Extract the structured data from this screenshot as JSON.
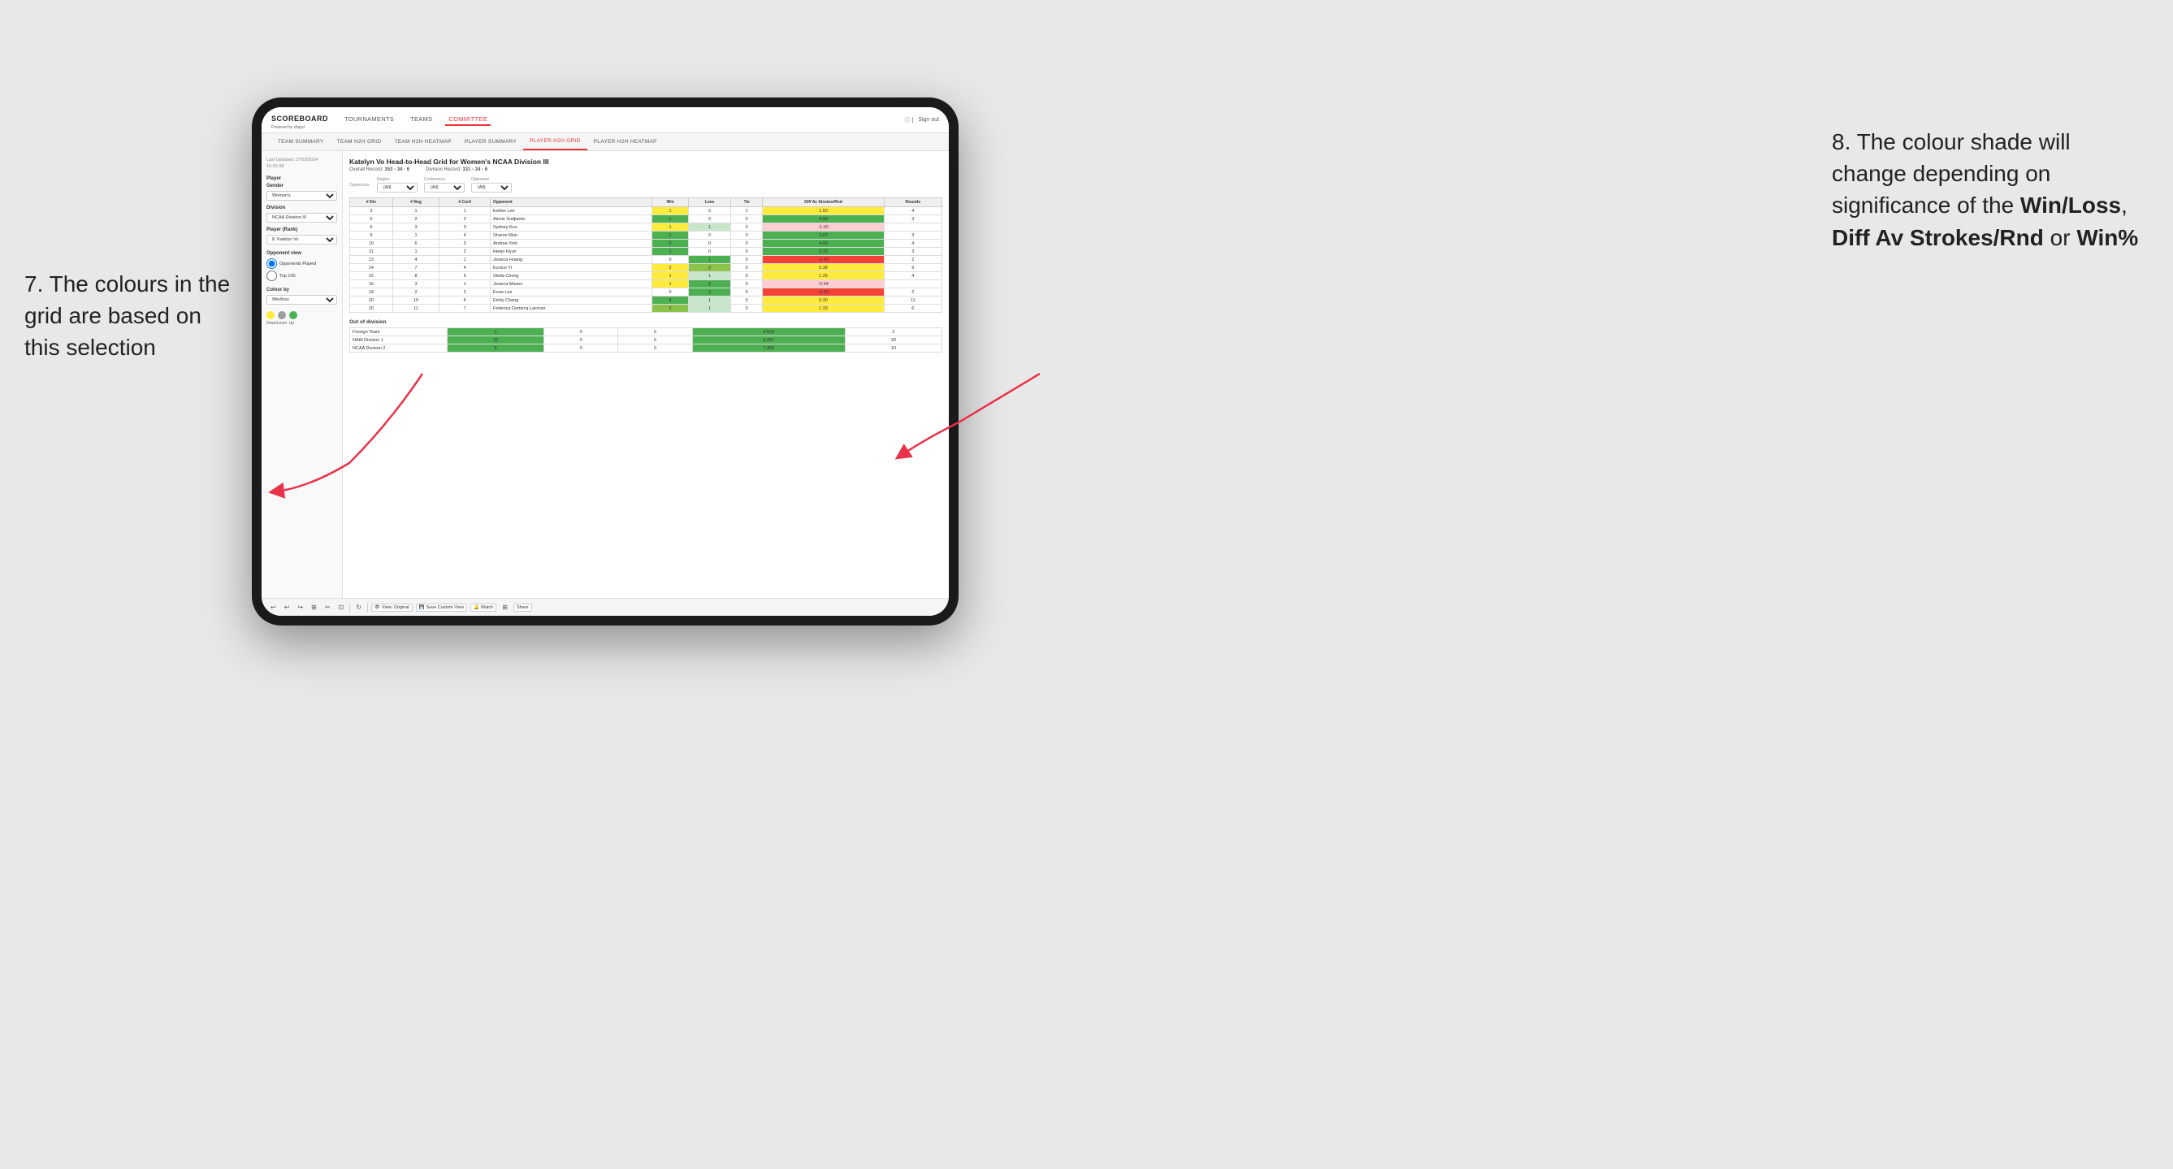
{
  "annotations": {
    "left": {
      "text": "7. The colours in the grid are based on this selection"
    },
    "right": {
      "intro": "8. The colour shade will change depending on significance of the ",
      "bold1": "Win/Loss",
      "sep1": ", ",
      "bold2": "Diff Av Strokes/Rnd",
      "sep2": " or ",
      "bold3": "Win%"
    }
  },
  "app": {
    "logo": "SCOREBOARD",
    "logo_sub": "Powered by clippd",
    "nav": [
      "TOURNAMENTS",
      "TEAMS",
      "COMMITTEE"
    ],
    "active_nav": "COMMITTEE",
    "header_right": [
      "Sign out"
    ],
    "sub_nav": [
      "TEAM SUMMARY",
      "TEAM H2H GRID",
      "TEAM H2H HEATMAP",
      "PLAYER SUMMARY",
      "PLAYER H2H GRID",
      "PLAYER H2H HEATMAP"
    ],
    "active_sub": "PLAYER H2H GRID"
  },
  "left_panel": {
    "last_updated_label": "Last Updated: 27/03/2024\n16:55:38",
    "player_section": "Player",
    "gender_label": "Gender",
    "gender_value": "Women's",
    "division_label": "Division",
    "division_value": "NCAA Division III",
    "player_rank_label": "Player (Rank)",
    "player_rank_value": "8. Katelyn Vo",
    "opponent_view_label": "Opponent view",
    "opponent_played": "Opponents Played",
    "opponent_top100": "Top 100",
    "colour_by_label": "Colour by",
    "colour_by_value": "Win/loss",
    "legend_labels": [
      "Down",
      "Level",
      "Up"
    ]
  },
  "grid": {
    "title": "Katelyn Vo Head-to-Head Grid for Women's NCAA Division III",
    "overall_record": "353 - 34 - 6",
    "division_record": "331 - 34 - 6",
    "filter_opponents_label": "Opponents:",
    "filter_region_label": "Region",
    "filter_conference_label": "Conference",
    "filter_opponent_label": "Opponent",
    "filter_all": "(All)",
    "table_headers": [
      "# Div",
      "# Reg",
      "# Conf",
      "Opponent",
      "Win",
      "Loss",
      "Tie",
      "Diff Av Strokes/Rnd",
      "Rounds"
    ],
    "rows": [
      {
        "div": "3",
        "reg": "1",
        "conf": "1",
        "opponent": "Esther Lee",
        "win": 1,
        "loss": 0,
        "tie": 1,
        "diff": 1.5,
        "rounds": 4,
        "win_color": "yellow",
        "loss_color": "white",
        "tie_color": "grey",
        "diff_color": "yellow"
      },
      {
        "div": "5",
        "reg": "2",
        "conf": "2",
        "opponent": "Alexis Sudjianto",
        "win": 1,
        "loss": 0,
        "tie": 0,
        "diff": 4.0,
        "rounds": 3,
        "win_color": "green_dark",
        "loss_color": "white",
        "tie_color": "grey",
        "diff_color": "green_dark"
      },
      {
        "div": "6",
        "reg": "3",
        "conf": "3",
        "opponent": "Sydney Kuo",
        "win": 1,
        "loss": 1,
        "tie": 0,
        "diff": -1.0,
        "rounds": "",
        "win_color": "yellow",
        "loss_color": "green_light",
        "tie_color": "grey",
        "diff_color": "red_light"
      },
      {
        "div": "9",
        "reg": "1",
        "conf": "4",
        "opponent": "Sharon Mun",
        "win": 1,
        "loss": 0,
        "tie": 0,
        "diff": 3.67,
        "rounds": 3,
        "win_color": "green_dark",
        "loss_color": "white",
        "tie_color": "grey",
        "diff_color": "green_dark"
      },
      {
        "div": "10",
        "reg": "6",
        "conf": "3",
        "opponent": "Andrea York",
        "win": 2,
        "loss": 0,
        "tie": 0,
        "diff": 4.0,
        "rounds": 4,
        "win_color": "green_dark",
        "loss_color": "white",
        "tie_color": "grey",
        "diff_color": "green_dark"
      },
      {
        "div": "11",
        "reg": "1",
        "conf": "2",
        "opponent": "Heejo Hyun",
        "win": 1,
        "loss": 0,
        "tie": 0,
        "diff": 3.33,
        "rounds": 3,
        "win_color": "green_dark",
        "loss_color": "white",
        "tie_color": "grey",
        "diff_color": "green_dark"
      },
      {
        "div": "13",
        "reg": "4",
        "conf": "1",
        "opponent": "Jessica Huang",
        "win": 0,
        "loss": 1,
        "tie": 0,
        "diff": -3.0,
        "rounds": 2,
        "win_color": "white",
        "loss_color": "green_dark",
        "tie_color": "grey",
        "diff_color": "red_dark"
      },
      {
        "div": "14",
        "reg": "7",
        "conf": "4",
        "opponent": "Eunice Yi",
        "win": 2,
        "loss": 2,
        "tie": 0,
        "diff": 0.38,
        "rounds": 9,
        "win_color": "yellow",
        "loss_color": "green_med",
        "tie_color": "grey",
        "diff_color": "yellow"
      },
      {
        "div": "15",
        "reg": "8",
        "conf": "5",
        "opponent": "Stella Cheng",
        "win": 1,
        "loss": 1,
        "tie": 0,
        "diff": 1.25,
        "rounds": 4,
        "win_color": "yellow",
        "loss_color": "green_light",
        "tie_color": "grey",
        "diff_color": "yellow"
      },
      {
        "div": "16",
        "reg": "3",
        "conf": "1",
        "opponent": "Jessica Mason",
        "win": 1,
        "loss": 2,
        "tie": 0,
        "diff": -0.94,
        "rounds": "",
        "win_color": "yellow",
        "loss_color": "green_dark",
        "tie_color": "grey",
        "diff_color": "red_light"
      },
      {
        "div": "18",
        "reg": "2",
        "conf": "2",
        "opponent": "Euna Lee",
        "win": 0,
        "loss": 3,
        "tie": 0,
        "diff": -5.0,
        "rounds": 2,
        "win_color": "white",
        "loss_color": "green_dark",
        "tie_color": "grey",
        "diff_color": "red_dark"
      },
      {
        "div": "20",
        "reg": "10",
        "conf": "6",
        "opponent": "Emily Chang",
        "win": 4,
        "loss": 1,
        "tie": 0,
        "diff": 0.3,
        "rounds": 11,
        "win_color": "green_dark",
        "loss_color": "green_light",
        "tie_color": "grey",
        "diff_color": "yellow"
      },
      {
        "div": "20",
        "reg": "11",
        "conf": "7",
        "opponent": "Federica Domecq Lacroze",
        "win": 2,
        "loss": 1,
        "tie": 0,
        "diff": 1.33,
        "rounds": 6,
        "win_color": "green_med",
        "loss_color": "green_light",
        "tie_color": "grey",
        "diff_color": "yellow"
      }
    ],
    "out_of_division_label": "Out of division",
    "out_of_division_rows": [
      {
        "opponent": "Foreign Team",
        "win": 1,
        "loss": 0,
        "tie": 0,
        "diff": 4.5,
        "rounds": 2,
        "win_color": "green_dark",
        "loss_color": "white",
        "diff_color": "green_dark"
      },
      {
        "opponent": "NAIA Division 1",
        "win": 15,
        "loss": 0,
        "tie": 0,
        "diff": 9.267,
        "rounds": 30,
        "win_color": "green_dark",
        "loss_color": "white",
        "diff_color": "green_dark"
      },
      {
        "opponent": "NCAA Division 2",
        "win": 5,
        "loss": 0,
        "tie": 0,
        "diff": 7.4,
        "rounds": 10,
        "win_color": "green_dark",
        "loss_color": "white",
        "diff_color": "green_dark"
      }
    ]
  },
  "toolbar": {
    "view_original": "View: Original",
    "save_custom": "Save Custom View",
    "watch": "Watch",
    "share": "Share"
  }
}
